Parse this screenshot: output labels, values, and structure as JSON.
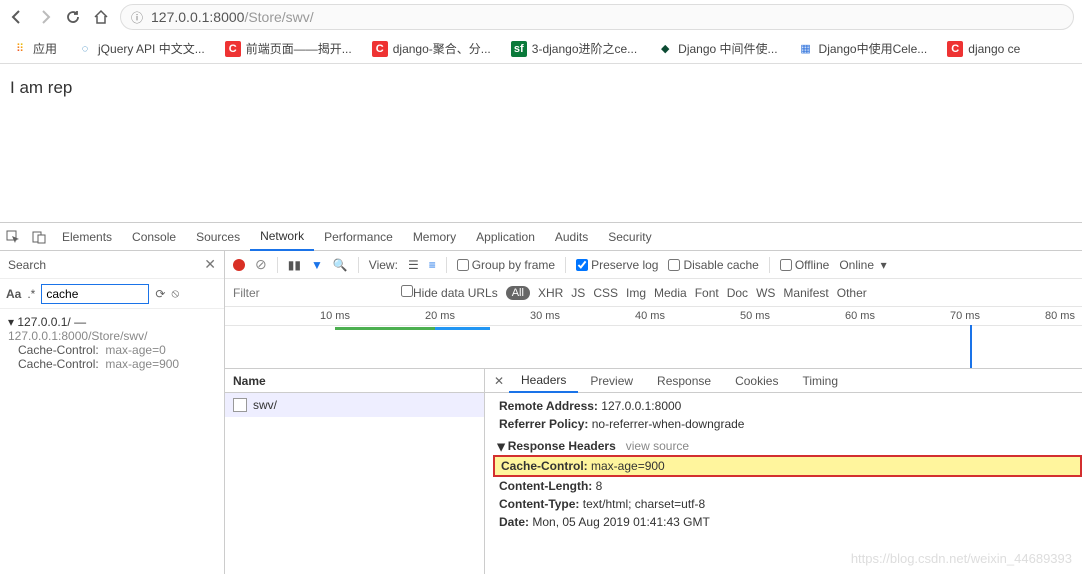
{
  "browser": {
    "url_host": "127.0.0.1:8000",
    "url_path": "/Store/swv/"
  },
  "bookmarks": {
    "apps": "应用",
    "items": [
      {
        "label": "jQuery API 中文文..."
      },
      {
        "label": "前端页面——揭开..."
      },
      {
        "label": "django-聚合、分..."
      },
      {
        "label": "3-django进阶之ce..."
      },
      {
        "label": "Django 中间件使..."
      },
      {
        "label": "Django中使用Cele..."
      },
      {
        "label": "django ce"
      }
    ]
  },
  "page": {
    "text": "I am rep"
  },
  "devtools": {
    "tabs": [
      "Elements",
      "Console",
      "Sources",
      "Network",
      "Performance",
      "Memory",
      "Application",
      "Audits",
      "Security"
    ],
    "active_tab": "Network",
    "search": {
      "label": "Search",
      "aa": "Aa",
      "regex": ".*",
      "value": "cache"
    },
    "tree": {
      "host": "127.0.0.1/",
      "path": "127.0.0.1:8000/Store/swv/",
      "cc1_k": "Cache-Control:",
      "cc1_v": "max-age=0",
      "cc2_k": "Cache-Control:",
      "cc2_v": "max-age=900"
    },
    "net_toolbar": {
      "view": "View:",
      "group": "Group by frame",
      "preserve": "Preserve log",
      "disable": "Disable cache",
      "offline": "Offline",
      "online": "Online"
    },
    "net_filter": {
      "placeholder": "Filter",
      "hide": "Hide data URLs",
      "all": "All",
      "types": [
        "XHR",
        "JS",
        "CSS",
        "Img",
        "Media",
        "Font",
        "Doc",
        "WS",
        "Manifest",
        "Other"
      ]
    },
    "timeline": {
      "ticks": [
        "10 ms",
        "20 ms",
        "30 ms",
        "40 ms",
        "50 ms",
        "60 ms",
        "70 ms",
        "80 ms"
      ]
    },
    "names": {
      "header": "Name",
      "row": "swv/"
    },
    "detail": {
      "tabs": [
        "Headers",
        "Preview",
        "Response",
        "Cookies",
        "Timing"
      ],
      "active": "Headers",
      "remote_k": "Remote Address:",
      "remote_v": "127.0.0.1:8000",
      "refpol_k": "Referrer Policy:",
      "refpol_v": "no-referrer-when-downgrade",
      "section": "Response Headers",
      "view_source": "view source",
      "cache_k": "Cache-Control:",
      "cache_v": "max-age=900",
      "clen_k": "Content-Length:",
      "clen_v": "8",
      "ctype_k": "Content-Type:",
      "ctype_v": "text/html; charset=utf-8",
      "date_k": "Date:",
      "date_v": "Mon, 05 Aug 2019 01:41:43 GMT"
    }
  },
  "watermark": "https://blog.csdn.net/weixin_44689393"
}
